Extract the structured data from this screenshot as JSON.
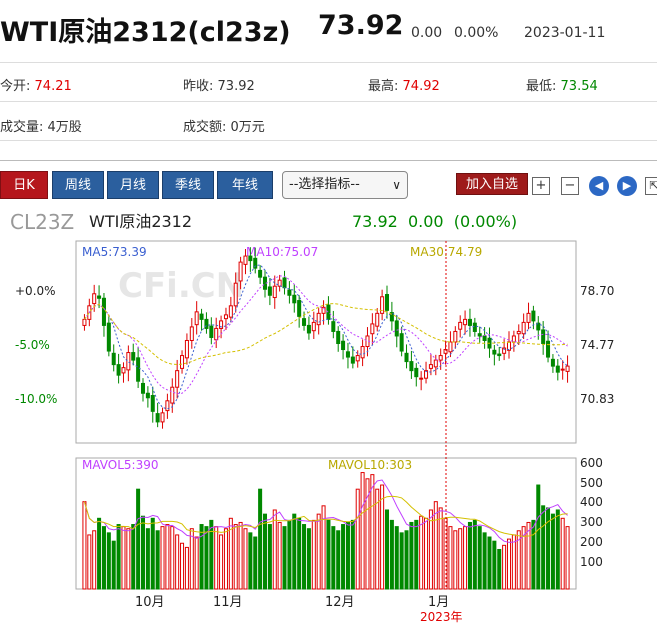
{
  "header": {
    "title": "WTI原油2312(cl23z)",
    "price": "73.92",
    "change": "0.00",
    "change_pct": "0.00%",
    "date": "2023-01-11"
  },
  "quote": {
    "open_label": "今开:",
    "open_value": "74.21",
    "prev_close_label": "昨收:",
    "prev_close_value": "73.92",
    "high_label": "最高:",
    "high_value": "74.92",
    "low_label": "最低:",
    "low_value": "73.54",
    "volume_label": "成交量:",
    "volume_value": "4万股",
    "amount_label": "成交额:",
    "amount_value": "0万元"
  },
  "toolbar": {
    "tabs": [
      "日K",
      "周线",
      "月线",
      "季线",
      "年线"
    ],
    "active_tab": "日K",
    "indicator_select": "--选择指标--",
    "add_watchlist": "加入自选"
  },
  "chart_data": [
    {
      "type": "candlestick",
      "symbol": "CL23Z",
      "name": "WTI原油2312",
      "price_line": "73.92  0.00  (0.00%)",
      "ma_labels": {
        "ma5": "MA5:73.39",
        "ma10": "MA10:75.07",
        "ma30": "MA30:74.79"
      },
      "left_axis": [
        "+0.0%",
        "-5.0%",
        "-10.0%"
      ],
      "right_axis": [
        "78.70",
        "74.77",
        "70.83"
      ],
      "x_labels": [
        "10月",
        "11月",
        "12月",
        "1月"
      ],
      "x_year_label": "2023年",
      "watermark": "CFi.CN",
      "ylim": [
        68.8,
        82.2
      ],
      "colors": {
        "up": "#e00000",
        "down": "#008800",
        "ma5": "#3a5fd0",
        "ma10": "#c040ff",
        "ma30": "#d4c000"
      },
      "close": [
        77.0,
        77.9,
        78.7,
        78.4,
        76.6,
        74.9,
        74.0,
        73.3,
        73.8,
        74.8,
        74.3,
        72.9,
        72.1,
        71.8,
        70.9,
        70.2,
        70.8,
        71.6,
        72.5,
        73.6,
        74.6,
        75.6,
        76.5,
        77.5,
        77.0,
        76.4,
        75.8,
        76.4,
        76.9,
        77.3,
        77.9,
        79.4,
        80.8,
        81.2,
        80.9,
        80.4,
        79.8,
        79.0,
        78.6,
        79.2,
        79.6,
        79.1,
        78.6,
        78.1,
        77.2,
        76.6,
        76.1,
        76.8,
        77.4,
        77.8,
        77.0,
        76.2,
        75.4,
        75.0,
        74.5,
        74.1,
        74.6,
        75.2,
        75.9,
        76.7,
        77.4,
        78.5,
        77.6,
        76.9,
        75.9,
        74.9,
        74.2,
        73.6,
        73.2,
        73.1,
        73.6,
        74.0,
        74.3,
        74.6,
        75.0,
        75.5,
        76.2,
        76.8,
        77.0,
        76.6,
        76.2,
        75.9,
        75.6,
        75.1,
        74.7,
        74.6,
        75.1,
        75.5,
        75.9,
        76.2,
        76.8,
        77.4,
        76.9,
        76.3,
        75.4,
        74.5,
        73.9,
        73.5,
        73.7,
        73.9
      ]
    },
    {
      "type": "bar",
      "name": "volume",
      "ma_labels": {
        "mavol5": "MAVOL5:390",
        "mavol10": "MAVOL10:303"
      },
      "right_axis": [
        "600",
        "500",
        "400",
        "300",
        "200",
        "100"
      ],
      "ylim": [
        0,
        630
      ],
      "values": [
        420,
        260,
        280,
        340,
        300,
        270,
        230,
        310,
        300,
        290,
        310,
        480,
        350,
        290,
        340,
        280,
        300,
        310,
        300,
        260,
        220,
        200,
        290,
        250,
        310,
        300,
        330,
        300,
        260,
        290,
        340,
        310,
        320,
        290,
        270,
        250,
        480,
        360,
        310,
        380,
        320,
        300,
        330,
        360,
        340,
        310,
        290,
        330,
        360,
        400,
        330,
        300,
        280,
        310,
        320,
        330,
        480,
        560,
        530,
        550,
        480,
        500,
        380,
        330,
        300,
        270,
        280,
        320,
        330,
        350,
        340,
        380,
        420,
        390,
        340,
        300,
        280,
        290,
        300,
        320,
        330,
        300,
        270,
        250,
        230,
        190,
        210,
        240,
        260,
        280,
        300,
        320,
        330,
        500,
        400,
        390,
        360,
        380,
        340,
        300
      ]
    }
  ]
}
